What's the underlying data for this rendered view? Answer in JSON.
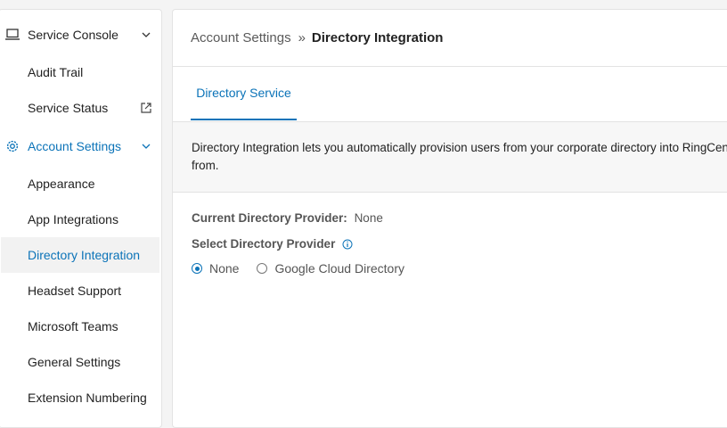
{
  "sidebar": {
    "items": [
      {
        "label": "Service Console",
        "icon": "laptop-icon",
        "trailing_icon": "chevron-down-icon"
      },
      {
        "label": "Audit Trail"
      },
      {
        "label": "Service Status",
        "trailing_icon": "external-link-icon"
      },
      {
        "label": "Account Settings",
        "icon": "gear-icon",
        "trailing_icon": "chevron-down-icon"
      },
      {
        "label": "Appearance"
      },
      {
        "label": "App Integrations"
      },
      {
        "label": "Directory Integration",
        "selected": true
      },
      {
        "label": "Headset Support"
      },
      {
        "label": "Microsoft Teams"
      },
      {
        "label": "General Settings"
      },
      {
        "label": "Extension Numbering"
      }
    ]
  },
  "breadcrumb": {
    "parent": "Account Settings",
    "separator": "»",
    "current": "Directory Integration"
  },
  "tabs": [
    {
      "label": "Directory Service",
      "active": true
    }
  ],
  "description": {
    "line1": "Directory Integration lets you automatically provision users from your corporate directory into RingCentral",
    "line2": "from."
  },
  "current_provider": {
    "label": "Current Directory Provider:",
    "value": "None"
  },
  "select_provider": {
    "label": "Select Directory Provider",
    "info_icon": "info-icon",
    "options": [
      {
        "label": "None",
        "selected": true
      },
      {
        "label": "Google Cloud Directory",
        "selected": false
      }
    ]
  },
  "colors": {
    "accent": "#0b73b8",
    "selected_bg": "#f2f2f2"
  }
}
